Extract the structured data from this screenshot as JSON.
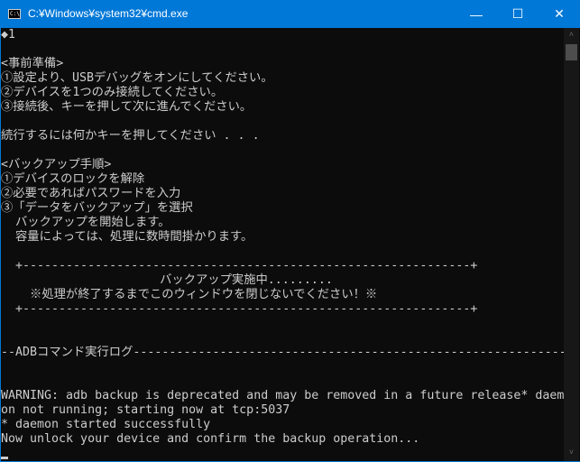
{
  "window": {
    "title": "C:¥Windows¥system32¥cmd.exe",
    "icon_label": "C:\\",
    "minimize": "—",
    "maximize": "☐",
    "close": "✕"
  },
  "console": {
    "lines": [
      "◆1",
      "",
      "<事前準備>",
      "①設定より、USBデバッグをオンにしてください。",
      "②デバイスを1つのみ接続してください。",
      "③接続後、キーを押して次に進んでください。",
      "",
      "続行するには何かキーを押してください . . .",
      "",
      "<バックアップ手順>",
      "①デバイスのロックを解除",
      "②必要であればパスワードを入力",
      "③「データをバックアップ」を選択",
      "  バックアップを開始します。",
      "  容量によっては、処理に数時間掛かります。",
      "",
      "  +--------------------------------------------------------------+",
      "                      バックアップ実施中.........",
      "    ※処理が終了するまでこのウィンドウを閉じないでください！※",
      "  +--------------------------------------------------------------+",
      "",
      "",
      "--ADBコマンド実行ログ----------------------------------------------------------------",
      "",
      "",
      "WARNING: adb backup is deprecated and may be removed in a future release* daem",
      "on not running; starting now at tcp:5037",
      "* daemon started successfully",
      "Now unlock your device and confirm the backup operation..."
    ]
  },
  "scrollbar": {
    "up": "˄",
    "down": "˅"
  }
}
